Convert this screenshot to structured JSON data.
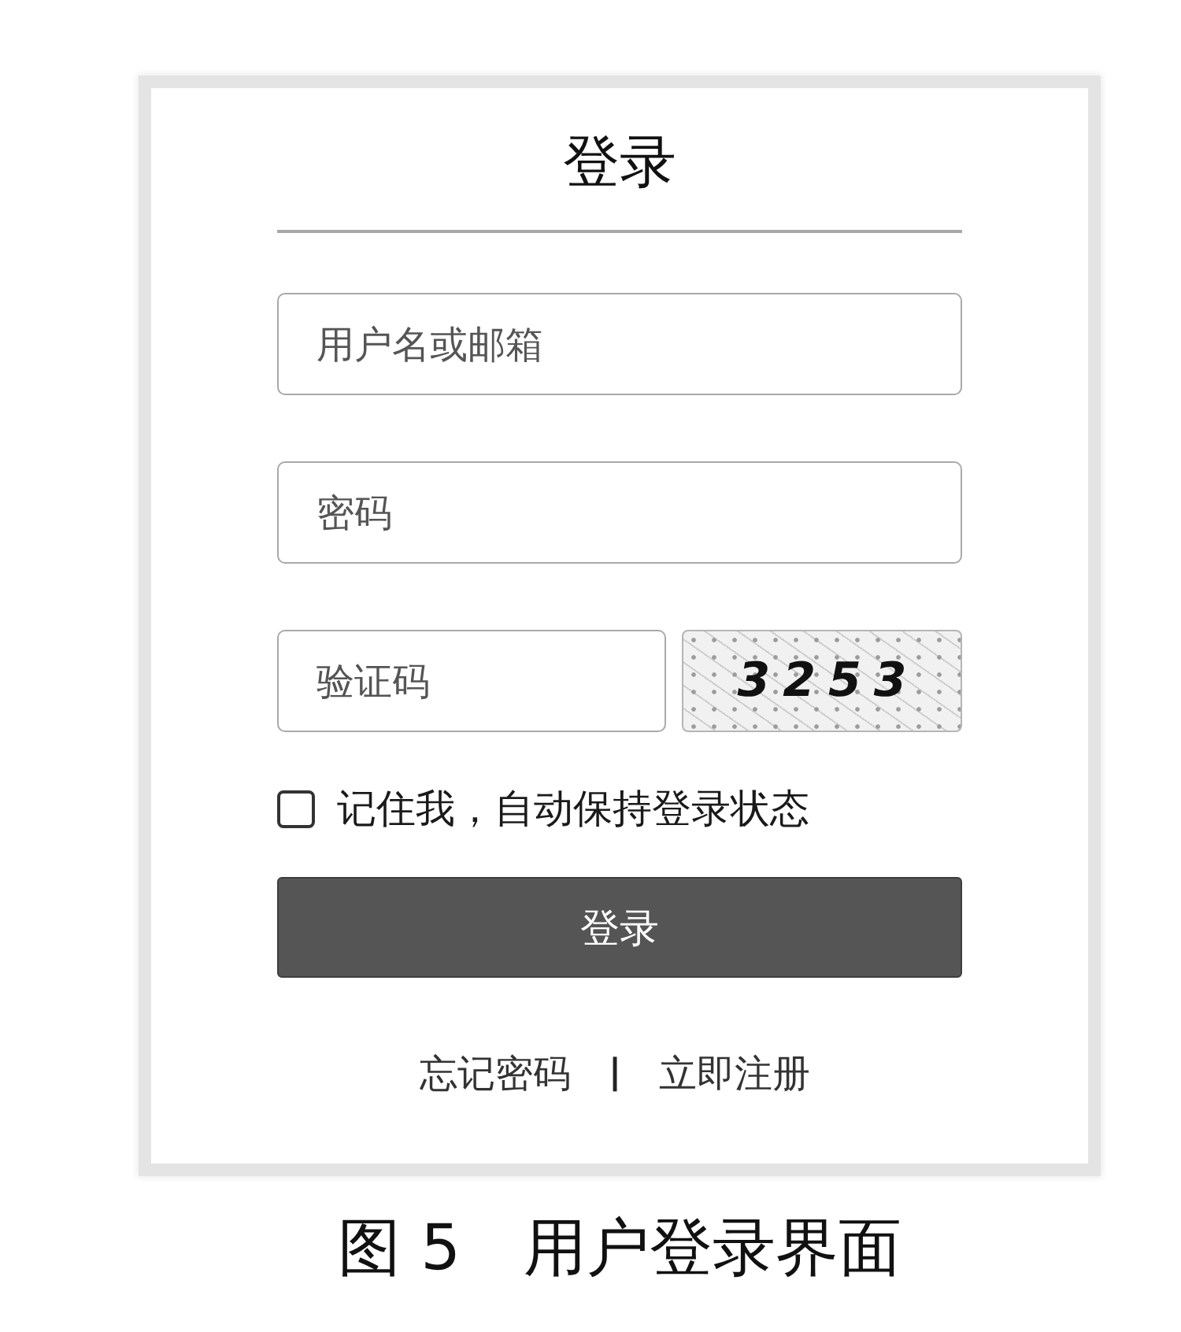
{
  "login_card": {
    "title": "登录",
    "fields": [
      {
        "kind": "text",
        "placeholder": "用户名或邮箱"
      },
      {
        "kind": "password",
        "placeholder": "密码"
      },
      {
        "kind": "captcha",
        "placeholder": "验证码",
        "captcha_code": "3253"
      }
    ],
    "remember": {
      "label": "记住我，自动保持登录状态",
      "checked": false
    },
    "submit_button": "登录",
    "links": [
      {
        "label": "忘记密码"
      },
      {
        "label": "立即注册"
      }
    ],
    "link_separator": "|"
  },
  "caption": "图 5　用户登录界面"
}
